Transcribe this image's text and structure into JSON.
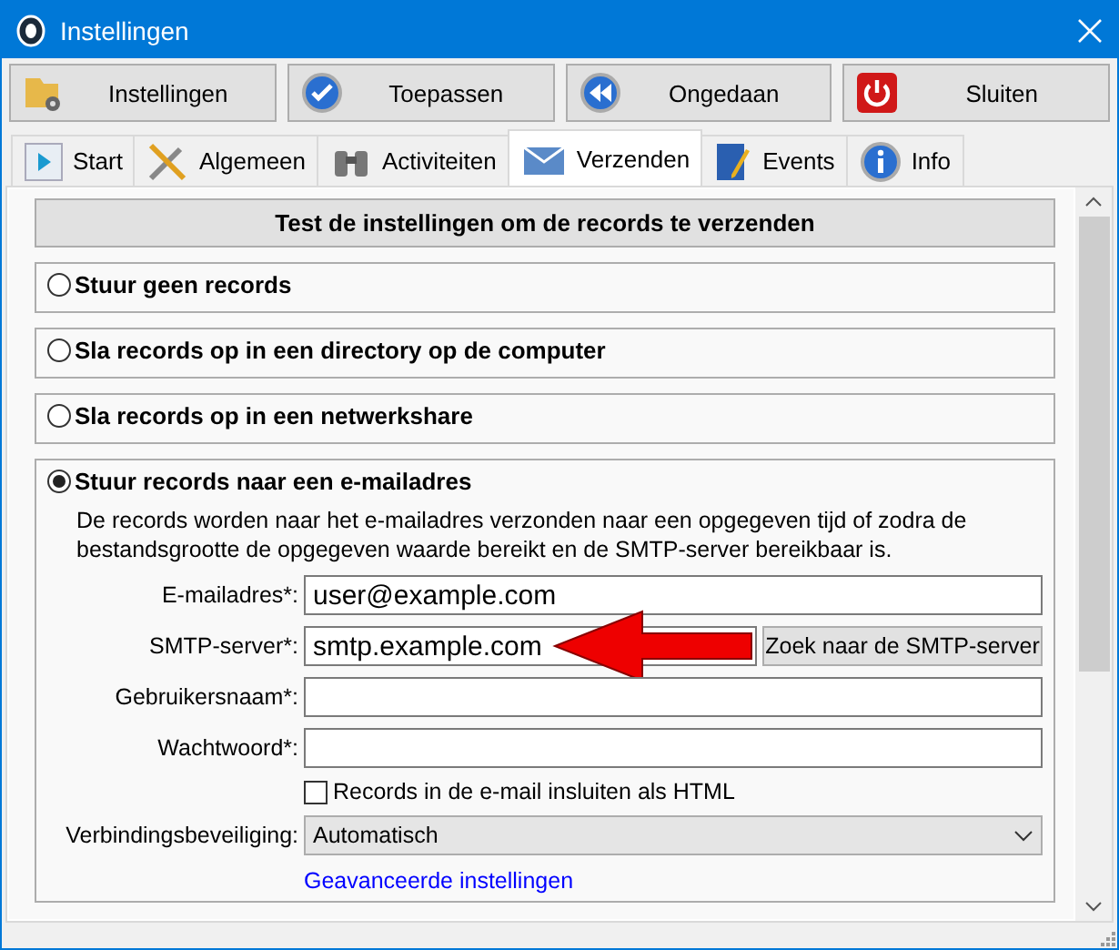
{
  "window": {
    "title": "Instellingen"
  },
  "toolbar": [
    {
      "label": "Instellingen"
    },
    {
      "label": "Toepassen"
    },
    {
      "label": "Ongedaan"
    },
    {
      "label": "Sluiten"
    }
  ],
  "tabs": [
    {
      "label": "Start",
      "selected": false
    },
    {
      "label": "Algemeen",
      "selected": false
    },
    {
      "label": "Activiteiten",
      "selected": false
    },
    {
      "label": "Verzenden",
      "selected": true
    },
    {
      "label": "Events",
      "selected": false
    },
    {
      "label": "Info",
      "selected": false
    }
  ],
  "test_button": "Test de instellingen om de records te verzenden",
  "options": [
    {
      "label": "Stuur geen records",
      "selected": false
    },
    {
      "label": "Sla records op in een directory op de computer",
      "selected": false
    },
    {
      "label": "Sla records op in een netwerkshare",
      "selected": false
    },
    {
      "label": "Stuur records naar een e-mailadres",
      "selected": true,
      "description": "De records worden naar het e-mailadres verzonden naar een opgegeven tijd of zodra de bestandsgrootte de opgegeven waarde bereikt en de SMTP-server bereikbaar is.",
      "fields": [
        {
          "label": "E-mailadres*:",
          "value": "user@example.com"
        },
        {
          "label": "SMTP-server*:",
          "value": "smtp.example.com",
          "button": "Zoek naar de SMTP-server"
        },
        {
          "label": "Gebruikersnaam*:"
        },
        {
          "label": "Wachtwoord*:"
        }
      ],
      "checkbox": {
        "label": "Records in de e-mail insluiten als HTML",
        "checked": false
      },
      "security": {
        "label": "Verbindingsbeveiliging:",
        "value": "Automatisch"
      },
      "link": "Geavanceerde instellingen"
    }
  ]
}
